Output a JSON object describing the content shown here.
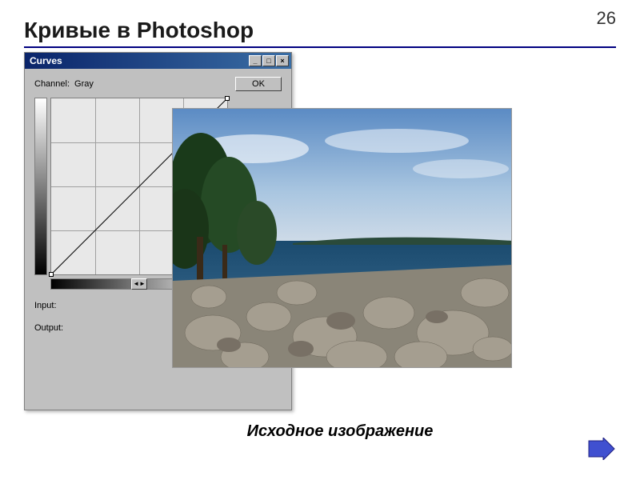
{
  "page_number": "26",
  "title": "Кривые  в Photoshop",
  "dialog": {
    "title": "Curves",
    "channel_label": "Channel:",
    "channel_value": "Gray",
    "ok_button": "OK",
    "input_label": "Input:",
    "output_label": "Output:",
    "slider_glyph": "◄►"
  },
  "caption": "Исходное изображение",
  "window_controls": {
    "minimize": "_",
    "maximize": "□",
    "close": "×"
  }
}
